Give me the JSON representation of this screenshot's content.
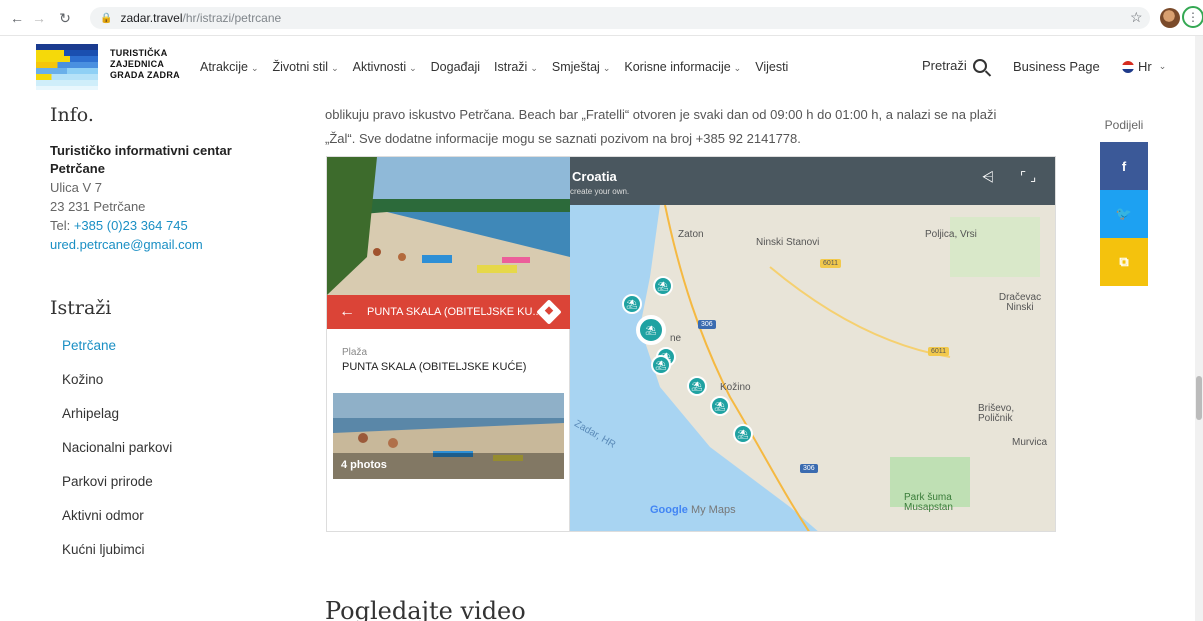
{
  "browser": {
    "url_host": "zadar.travel",
    "url_path": "/hr/istrazi/petrcane"
  },
  "header": {
    "logo_lines": [
      "TURISTIČKA",
      "ZAJEDNICA",
      "GRADA ZADRA"
    ],
    "nav": [
      "Atrakcije",
      "Životni stil",
      "Aktivnosti",
      "Događaji",
      "Istraži",
      "Smještaj",
      "Korisne informacije",
      "Vijesti"
    ],
    "nav_has_caret": [
      true,
      true,
      true,
      false,
      true,
      true,
      true,
      false
    ],
    "search_label": "Pretraži",
    "business_label": "Business Page",
    "lang_label": "Hr"
  },
  "info": {
    "title": "Info.",
    "name_line1": "Turističko informativni centar",
    "name_line2": "Petrčane",
    "address1": "Ulica V 7",
    "address2": "23 231 Petrčane",
    "tel_prefix": "Tel: ",
    "tel": "+385 (0)23 364 745",
    "email": "ured.petrcane@gmail.com"
  },
  "istrazi": {
    "title": "Istraži",
    "items": [
      "Petrčane",
      "Kožino",
      "Arhipelag",
      "Nacionalni parkovi",
      "Parkovi prirode",
      "Aktivni odmor",
      "Kućni ljubimci"
    ]
  },
  "content": {
    "line1": "oblikuju pravo iskustvo Petrčana. Beach bar „Fratelli“ otvoren je svaki dan od 09:00 h do 01:00 h, a nalazi se na plaži",
    "line2": "„Žal“. Sve dodatne informacije mogu se saznati pozivom na broj +385 92 2141778."
  },
  "map": {
    "title": "Croatia",
    "subtitle": "create your own.",
    "panel_header": "PUNTA SKALA (OBITELJSKE KU...",
    "place_type": "Plaža",
    "place_name": "PUNTA SKALA (OBITELJSKE KUĆE)",
    "photos": "4 photos",
    "places": [
      "Zaton",
      "Ninski Stanovi",
      "Poljica, Vrsi",
      "Dračevac Ninski",
      "Kožino",
      "Briševo, Poličnik",
      "Murvica",
      "Park šuma Musapstan",
      "Zadar, HR",
      "ne"
    ],
    "roads": [
      "6011",
      "306",
      "6011",
      "306"
    ],
    "google": "Google",
    "mymaps": "My Maps"
  },
  "share": {
    "label": "Podijeli"
  },
  "video": {
    "title": "Pogledajte video"
  },
  "colors": {
    "accent_blue": "#1a8fc4",
    "facebook": "#3b5998",
    "twitter": "#1da1f2",
    "copy": "#f4c20d",
    "map_red": "#db4437"
  }
}
